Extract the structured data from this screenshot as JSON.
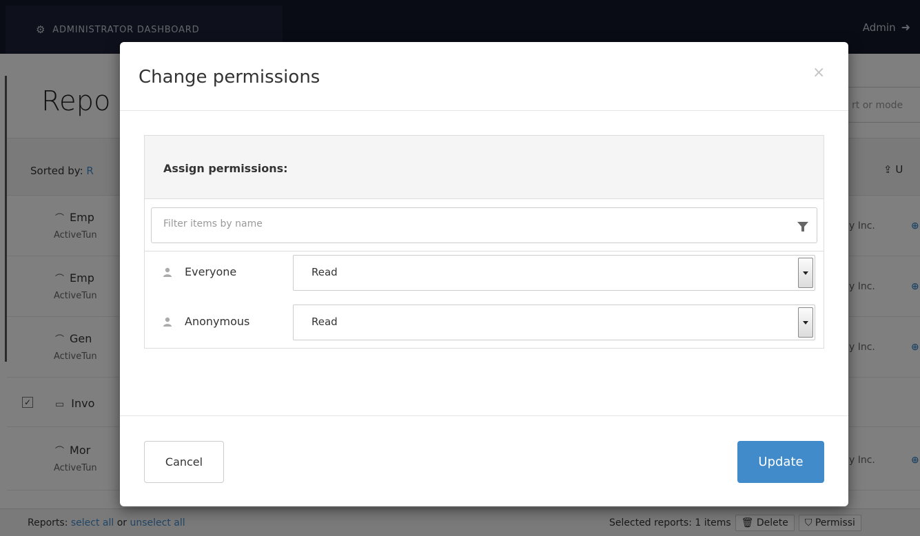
{
  "topbar": {
    "brand": "ADMINISTRATOR DASHBOARD",
    "brand_icon": "gears-icon",
    "admin_label": "Admin",
    "logout_icon": "logout-icon"
  },
  "page": {
    "title": "Repo",
    "search_placeholder": "rt or mode",
    "sorted_label": "Sorted by:",
    "sorted_value": "R",
    "upload_label": "U"
  },
  "reports": [
    {
      "name": "Emp",
      "sub": "ActiveTun",
      "company": "y Inc."
    },
    {
      "name": "Emp",
      "sub": "ActiveTun",
      "company": "y Inc."
    },
    {
      "name": "Gen",
      "sub": "ActiveTun",
      "company": "y Inc."
    },
    {
      "name": "Invo",
      "checked": true
    },
    {
      "name": "Mor",
      "sub": "ActiveTun",
      "company": "y Inc."
    }
  ],
  "footer": {
    "reports_label": "Reports:",
    "select_all": "select all",
    "or": "or",
    "unselect_all": "unselect all",
    "selected_text": "Selected reports: 1 items",
    "delete_label": "Delete",
    "permissions_label": "Permissi"
  },
  "modal": {
    "title": "Change permissions",
    "close_symbol": "×",
    "assign_title": "Assign permissions:",
    "filter_placeholder": "Filter items by name",
    "permissions": [
      {
        "name": "Everyone",
        "value": "Read"
      },
      {
        "name": "Anonymous",
        "value": "Read"
      }
    ],
    "cancel_label": "Cancel",
    "update_label": "Update"
  },
  "colors": {
    "accent": "#428bca",
    "topbar": "#13182a"
  }
}
